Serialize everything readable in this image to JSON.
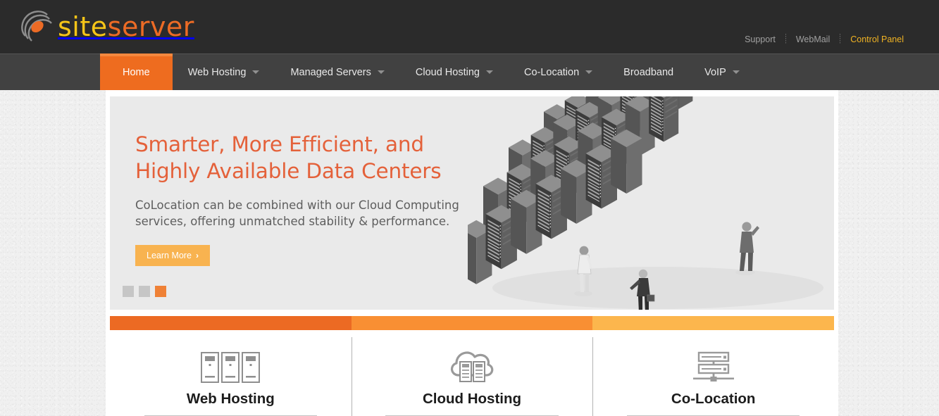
{
  "brand": {
    "name_part1": "site",
    "name_part2": "server",
    "logo_icon": "orbit-swoosh-logo",
    "color_yellow": "#f5c518",
    "color_orange": "#ec6b25"
  },
  "utility_nav": {
    "items": [
      {
        "label": "Support",
        "accent": false
      },
      {
        "label": "WebMail",
        "accent": false
      },
      {
        "label": "Control Panel",
        "accent": true
      }
    ],
    "accent_color": "#f0b323"
  },
  "main_nav": {
    "active_color": "#ee6c1f",
    "items": [
      {
        "label": "Home",
        "has_dropdown": false,
        "active": true
      },
      {
        "label": "Web Hosting",
        "has_dropdown": true,
        "active": false
      },
      {
        "label": "Managed Servers",
        "has_dropdown": true,
        "active": false
      },
      {
        "label": "Cloud Hosting",
        "has_dropdown": true,
        "active": false
      },
      {
        "label": "Co-Location",
        "has_dropdown": true,
        "active": false
      },
      {
        "label": "Broadband",
        "has_dropdown": false,
        "active": false
      },
      {
        "label": "VoIP",
        "has_dropdown": true,
        "active": false
      }
    ]
  },
  "hero": {
    "title_line1": "Smarter, More Efficient, and",
    "title_line2": "Highly Available Data Centers",
    "subtitle_line1": "CoLocation can be combined with our Cloud Computing",
    "subtitle_line2": "services, offering unmatched stability & performance.",
    "button_label": "Learn More",
    "button_chevron": "›",
    "title_color": "#e4613a",
    "button_color": "#f8b350",
    "illustration": "isometric-datacenter-server-racks",
    "slides": [
      {
        "active": false
      },
      {
        "active": false
      },
      {
        "active": true
      }
    ],
    "active_dot_color": "#ef8136"
  },
  "services": {
    "columns": [
      {
        "label": "Web Hosting",
        "bar_color": "#ec6a23",
        "icon": "server-towers-icon"
      },
      {
        "label": "Cloud Hosting",
        "bar_color": "#f98f33",
        "icon": "cloud-servers-icon"
      },
      {
        "label": "Co-Location",
        "bar_color": "#fcb64d",
        "icon": "rack-network-icon"
      }
    ]
  }
}
